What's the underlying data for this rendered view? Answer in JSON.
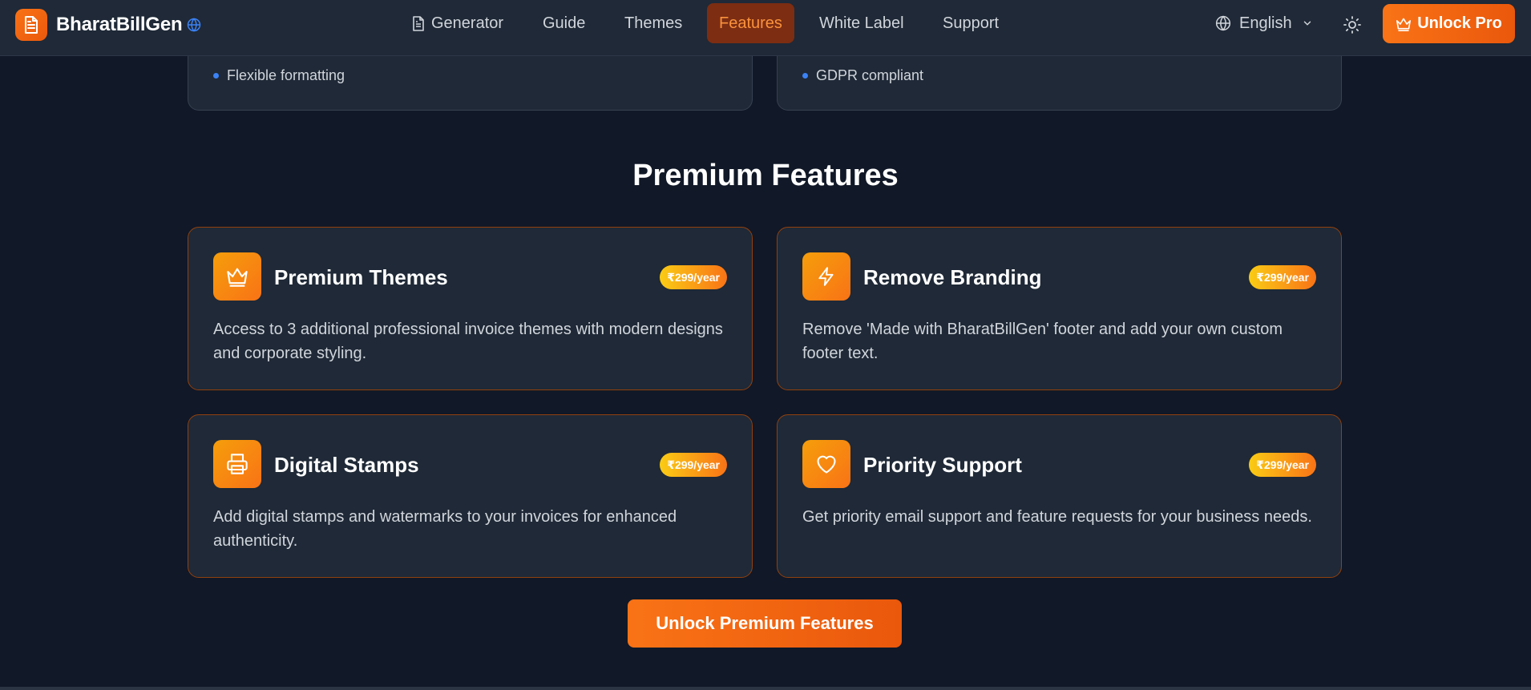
{
  "header": {
    "brand": "BharatBillGen",
    "nav": [
      {
        "label": "Generator",
        "icon": "document-icon",
        "active": false
      },
      {
        "label": "Guide",
        "active": false
      },
      {
        "label": "Themes",
        "active": false
      },
      {
        "label": "Features",
        "active": true
      },
      {
        "label": "White Label",
        "active": false
      },
      {
        "label": "Support",
        "active": false
      }
    ],
    "language": "English",
    "unlock_pro": "Unlock Pro"
  },
  "top_cards": [
    {
      "bullet": "Flexible formatting"
    },
    {
      "bullet": "GDPR compliant"
    }
  ],
  "section": {
    "title": "Premium Features",
    "cards": [
      {
        "title": "Premium Themes",
        "price": "₹299/year",
        "icon": "crown-icon",
        "desc": "Access to 3 additional professional invoice themes with modern designs and corporate styling."
      },
      {
        "title": "Remove Branding",
        "price": "₹299/year",
        "icon": "lightning-icon",
        "desc": "Remove 'Made with BharatBillGen' footer and add your own custom footer text."
      },
      {
        "title": "Digital Stamps",
        "price": "₹299/year",
        "icon": "printer-icon",
        "desc": "Add digital stamps and watermarks to your invoices for enhanced authenticity."
      },
      {
        "title": "Priority Support",
        "price": "₹299/year",
        "icon": "heart-icon",
        "desc": "Get priority email support and feature requests for your business needs."
      }
    ],
    "cta": "Unlock Premium Features"
  },
  "colors": {
    "background": "#111827",
    "card": "#1f2937",
    "accent": "#f97316",
    "card_border": "#92400e",
    "bullet": "#3b82f6"
  }
}
